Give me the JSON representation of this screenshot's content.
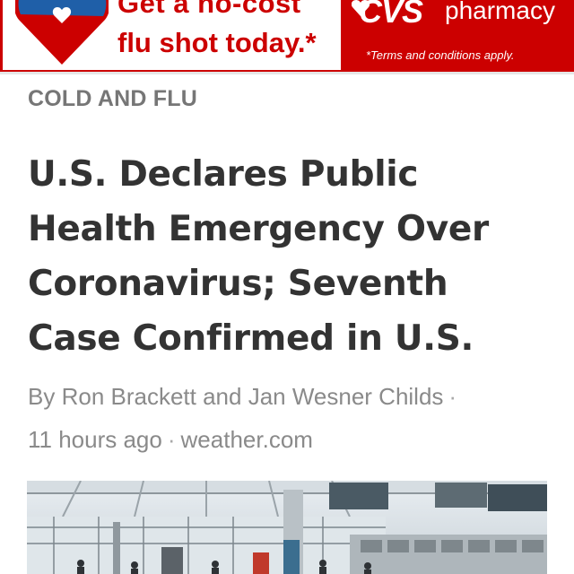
{
  "ad": {
    "headline_line1": "Get a no-cost",
    "headline_line2": "flu shot today.*",
    "brand_logo": "CVS",
    "brand_name": "pharmacy",
    "terms": "*Terms and conditions apply.",
    "colors": {
      "brand_red": "#cc0000",
      "heart_blue": "#1f5fa8"
    },
    "icons": [
      "heart-shield-icon",
      "cvs-heart-icon"
    ]
  },
  "article": {
    "category": "COLD AND FLU",
    "headline": "U.S. Declares Public Health Emergency Over Coronavirus; Seventh Case Confirmed in U.S.",
    "byline": {
      "prefix": "By",
      "authors": "Ron Brackett and Jan Wesner Childs",
      "separator": "·",
      "time": "11 hours ago",
      "source": "weather.com"
    },
    "colors": {
      "category": "#767676",
      "headline": "#333333",
      "meta": "#8a8a8a"
    }
  },
  "photo": {
    "icon": "airport-terminal-photo"
  }
}
